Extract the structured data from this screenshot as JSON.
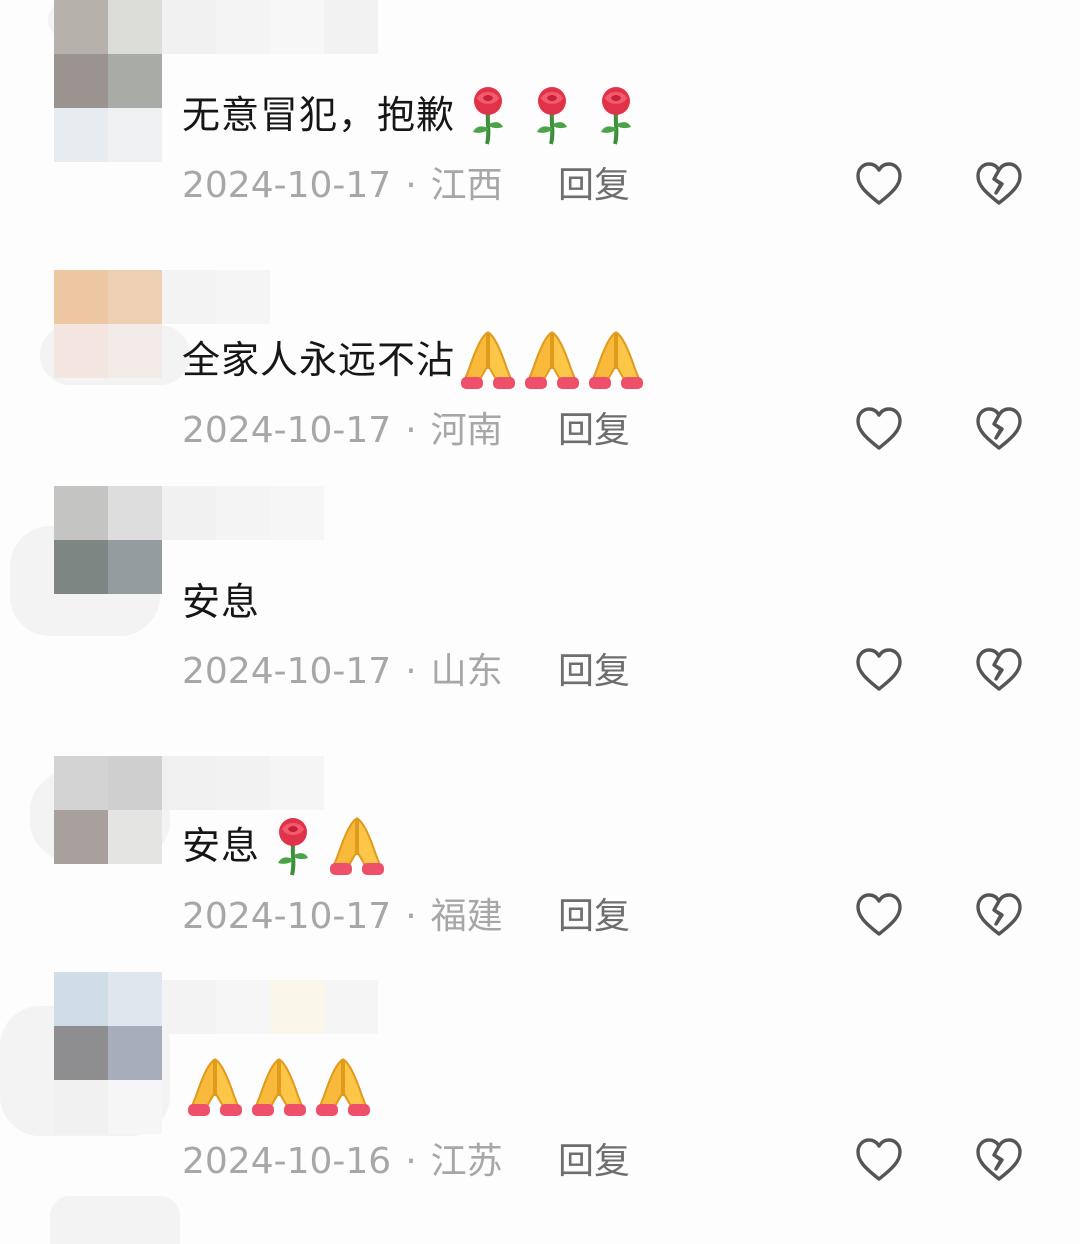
{
  "comments": [
    {
      "text": "无意冒犯，抱歉",
      "emojis": [
        "rose-icon",
        "rose-icon",
        "rose-icon"
      ],
      "date": "2024-10-17",
      "separator": "·",
      "location": "江西",
      "reply_label": "回复"
    },
    {
      "text": "全家人永远不沾",
      "emojis": [
        "folded-hands-icon",
        "folded-hands-icon",
        "folded-hands-icon"
      ],
      "date": "2024-10-17",
      "separator": "·",
      "location": "河南",
      "reply_label": "回复"
    },
    {
      "text": "安息",
      "emojis": [],
      "date": "2024-10-17",
      "separator": "·",
      "location": "山东",
      "reply_label": "回复"
    },
    {
      "text": "安息",
      "emojis": [
        "rose-icon",
        "folded-hands-icon"
      ],
      "date": "2024-10-17",
      "separator": "·",
      "location": "福建",
      "reply_label": "回复"
    },
    {
      "text": "",
      "emojis": [
        "folded-hands-icon",
        "folded-hands-icon",
        "folded-hands-icon"
      ],
      "date": "2024-10-16",
      "separator": "·",
      "location": "江苏",
      "reply_label": "回复"
    }
  ],
  "icons": {
    "like": "heart-outline-icon",
    "dislike": "broken-heart-outline-icon"
  },
  "colors": {
    "text": "#161616",
    "meta": "#a7a7a7",
    "reply": "#6e6e6e",
    "icon_stroke": "#555555",
    "background": "#fdfdfd"
  }
}
